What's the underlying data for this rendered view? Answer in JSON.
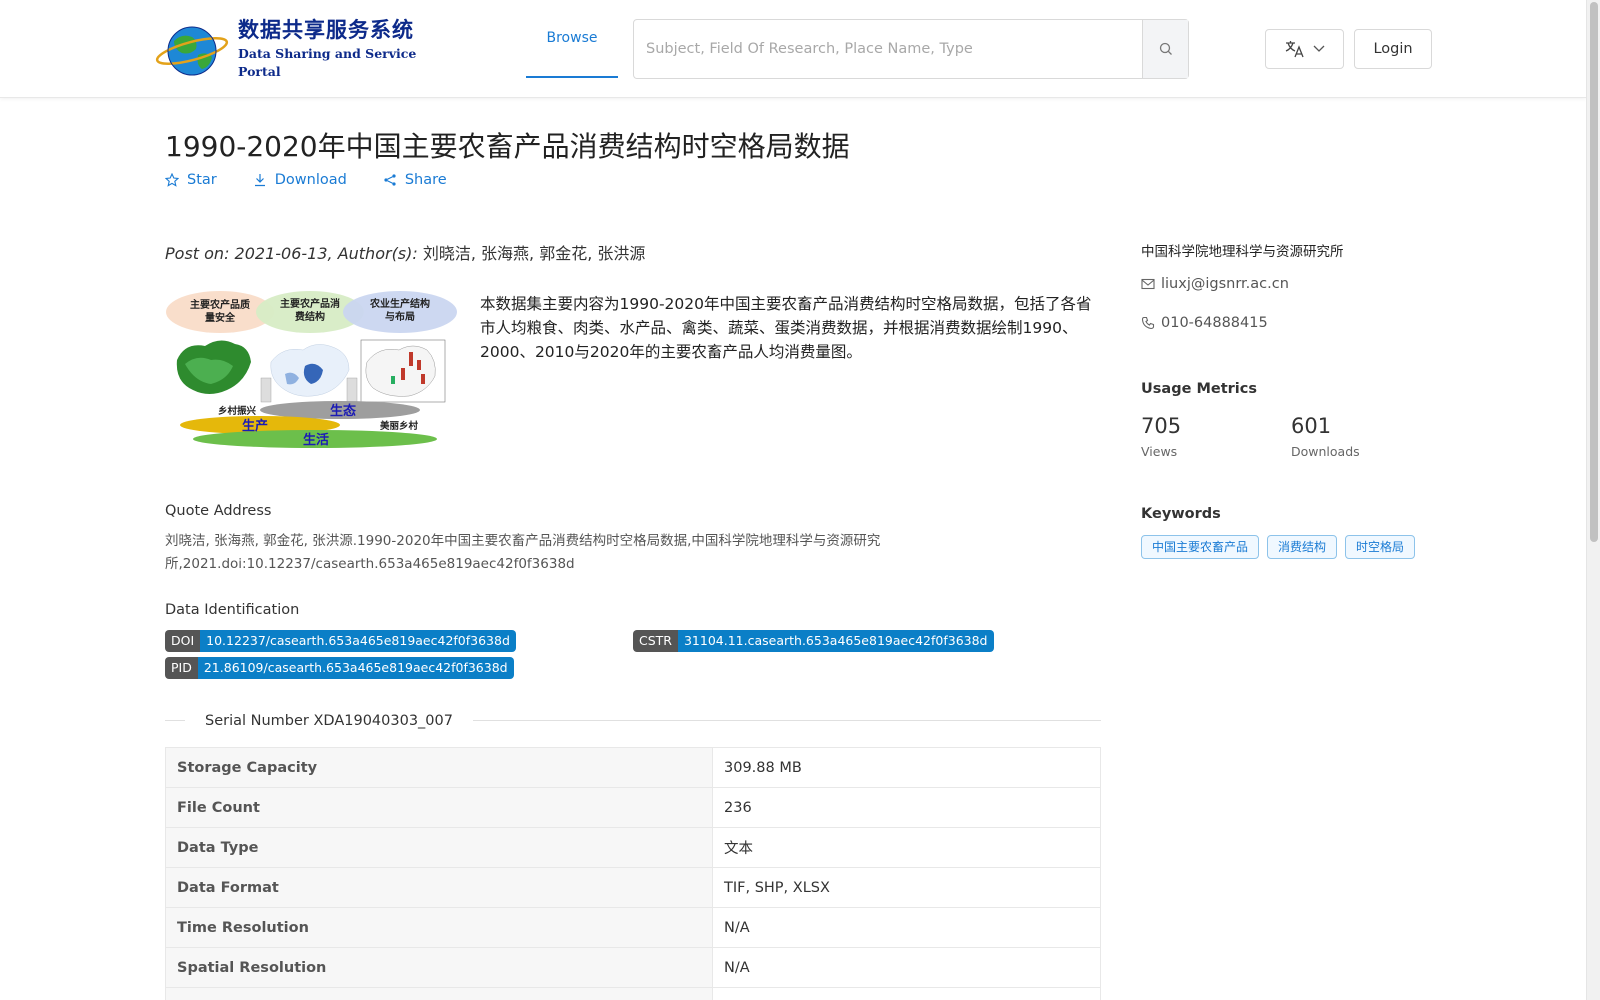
{
  "header": {
    "logo_cn": "数据共享服务系统",
    "logo_en": "Data Sharing and Service Portal",
    "nav_browse": "Browse",
    "search_placeholder": "Subject, Field Of Research, Place Name, Type",
    "login_label": "Login"
  },
  "dataset": {
    "title": "1990-2020年中国主要农畜产品消费结构时空格局数据",
    "actions": {
      "star": "Star",
      "download": "Download",
      "share": "Share"
    },
    "post_prefix": "Post on: 2021-06-13, Author(s):",
    "authors": "刘晓洁, 张海燕, 郭金花, 张洪源",
    "thumb_labels": {
      "bubble1": "主要农产品质量安全",
      "bubble2": "主要农产品消费结构",
      "bubble3": "农业生产结构与布局",
      "rural": "乡村振兴",
      "ecology": "生态",
      "production": "生产",
      "beautiful": "美丽乡村",
      "life": "生活"
    },
    "description": "本数据集主要内容为1990-2020年中国主要农畜产品消费结构时空格局数据，包括了各省市人均粮食、肉类、水产品、禽类、蔬菜、蛋类消费数据，并根据消费数据绘制1990、2000、2010与2020年的主要农畜产品人均消费量图。",
    "quote_label": "Quote Address",
    "quote_text": "刘晓洁, 张海燕, 郭金花, 张洪源.1990-2020年中国主要农畜产品消费结构时空格局数据,中国科学院地理科学与资源研究所,2021.doi:10.12237/casearth.653a465e819aec42f0f3638d",
    "ident_label": "Data Identification",
    "identifiers": {
      "doi_key": "DOI",
      "doi_val": "10.12237/casearth.653a465e819aec42f0f3638d",
      "cstr_key": "CSTR",
      "cstr_val": "31104.11.casearth.653a465e819aec42f0f3638d",
      "pid_key": "PID",
      "pid_val": "21.86109/casearth.653a465e819aec42f0f3638d"
    },
    "serial": "Serial Number XDA19040303_007",
    "info_rows": [
      {
        "key": "Storage Capacity",
        "value": "309.88 MB"
      },
      {
        "key": "File Count",
        "value": "236"
      },
      {
        "key": "Data Type",
        "value": "文本"
      },
      {
        "key": "Data Format",
        "value": "TIF, SHP, XLSX"
      },
      {
        "key": "Time Resolution",
        "value": "N/A"
      },
      {
        "key": "Spatial Resolution",
        "value": "N/A"
      }
    ]
  },
  "sidebar": {
    "org": "中国科学院地理科学与资源研究所",
    "email": "liuxj@igsnrr.ac.cn",
    "phone": "010-64888415",
    "usage_title": "Usage Metrics",
    "views_count": "705",
    "views_label": "Views",
    "downloads_count": "601",
    "downloads_label": "Downloads",
    "keywords_title": "Keywords",
    "keywords": [
      "中国主要农畜产品",
      "消费结构",
      "时空格局"
    ]
  },
  "colors": {
    "accent": "#1a7bd4",
    "badge_key": "#555555",
    "badge_value": "#0b7fc7",
    "logo": "#0d2a8a"
  },
  "icons": [
    "globe-logo-icon",
    "search-icon",
    "translate-icon",
    "chevron-down-icon",
    "star-icon",
    "download-icon",
    "share-icon",
    "mail-icon",
    "phone-icon"
  ]
}
